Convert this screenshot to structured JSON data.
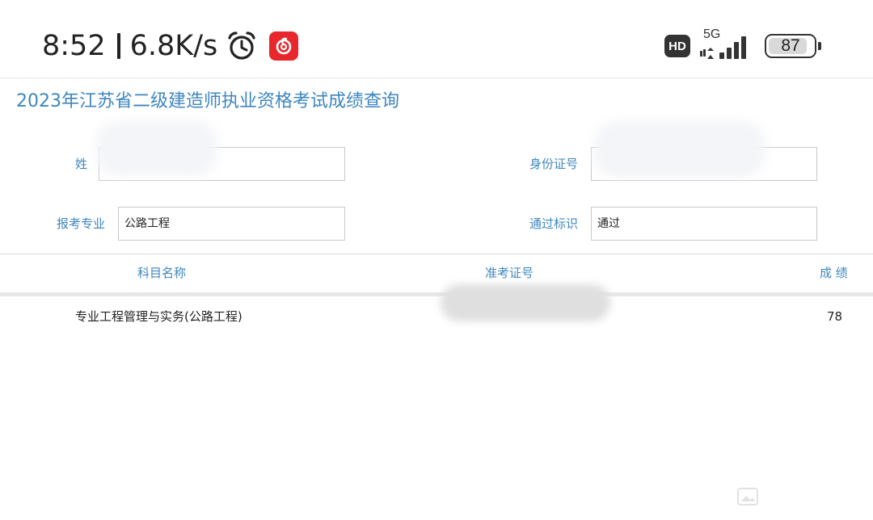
{
  "status_bar": {
    "time": "8:52",
    "net_speed": "6.8K/s",
    "hd_label": "HD",
    "network_type": "5G",
    "battery_level": "87",
    "battery_fraction": 0.87
  },
  "page": {
    "title": "2023年江苏省二级建造师执业资格考试成绩查询",
    "fields": {
      "name": {
        "label": "姓",
        "value": ""
      },
      "id_number": {
        "label": "身份证号",
        "value": ""
      },
      "major": {
        "label": "报考专业",
        "value": "公路工程"
      },
      "pass_flag": {
        "label": "通过标识",
        "value": "通过"
      }
    },
    "table": {
      "headers": [
        "科目名称",
        "准考证号",
        "成 绩"
      ],
      "rows": [
        {
          "subject": "专业工程管理与实务(公路工程)",
          "ticket_number": "",
          "score": "78"
        }
      ]
    }
  }
}
